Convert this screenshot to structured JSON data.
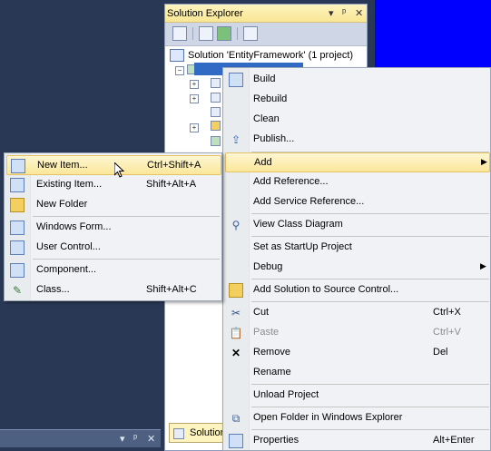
{
  "solution_explorer": {
    "title": "Solution Explorer",
    "title_buttons": {
      "dropdown": "▾",
      "pin": "ᵖ",
      "close": "✕"
    },
    "solution_label": "Solution 'EntityFramework' (1 project)",
    "bottom_tab_label": "Solution"
  },
  "dock_pane": {
    "dropdown": "▾",
    "pin": "ᵖ",
    "close": "✕"
  },
  "context_menu": {
    "items": [
      {
        "label": "Build",
        "icon": "build-icon"
      },
      {
        "label": "Rebuild",
        "icon": ""
      },
      {
        "label": "Clean",
        "icon": ""
      },
      {
        "label": "Publish...",
        "icon": "publish-icon"
      },
      {
        "label": "Add",
        "icon": "",
        "submenu": true,
        "highlighted": true
      },
      {
        "label": "Add Reference...",
        "icon": ""
      },
      {
        "label": "Add Service Reference...",
        "icon": ""
      },
      {
        "label": "View Class Diagram",
        "icon": "class-diagram-icon"
      },
      {
        "label": "Set as StartUp Project",
        "icon": ""
      },
      {
        "label": "Debug",
        "icon": "",
        "submenu": true
      },
      {
        "label": "Add Solution to Source Control...",
        "icon": "source-control-icon"
      },
      {
        "label": "Cut",
        "icon": "scissors-icon",
        "shortcut": "Ctrl+X"
      },
      {
        "label": "Paste",
        "icon": "paste-icon",
        "shortcut": "Ctrl+V",
        "disabled": true
      },
      {
        "label": "Remove",
        "icon": "remove-icon",
        "shortcut": "Del"
      },
      {
        "label": "Rename",
        "icon": ""
      },
      {
        "label": "Unload Project",
        "icon": ""
      },
      {
        "label": "Open Folder in Windows Explorer",
        "icon": "folder-open-icon"
      },
      {
        "label": "Properties",
        "icon": "properties-icon",
        "shortcut": "Alt+Enter"
      }
    ]
  },
  "add_submenu": {
    "items": [
      {
        "label": "New Item...",
        "shortcut": "Ctrl+Shift+A",
        "icon": "new-item-icon",
        "highlighted": true
      },
      {
        "label": "Existing Item...",
        "shortcut": "Shift+Alt+A",
        "icon": "existing-item-icon"
      },
      {
        "label": "New Folder",
        "shortcut": "",
        "icon": "new-folder-icon"
      },
      {
        "label": "Windows Form...",
        "shortcut": "",
        "icon": "windows-form-icon"
      },
      {
        "label": "User Control...",
        "shortcut": "",
        "icon": "user-control-icon"
      },
      {
        "label": "Component...",
        "shortcut": "",
        "icon": "component-icon"
      },
      {
        "label": "Class...",
        "shortcut": "Shift+Alt+C",
        "icon": "class-icon"
      }
    ]
  },
  "colors": {
    "ide_background": "#293955",
    "menu_highlight": "#fbe79a",
    "blue_area": "#0000ff",
    "selection": "#316ac5"
  }
}
